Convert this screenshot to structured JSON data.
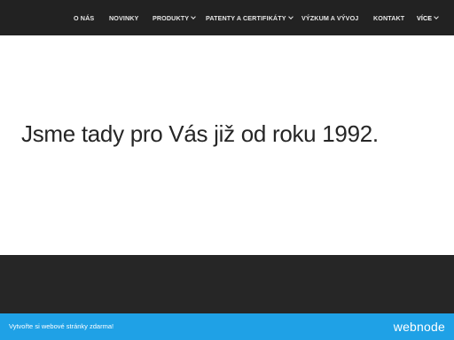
{
  "nav": {
    "items": [
      {
        "label": "O NÁS",
        "has_dropdown": false
      },
      {
        "label": "NOVINKY",
        "has_dropdown": false
      },
      {
        "label": "PRODUKTY",
        "has_dropdown": true
      },
      {
        "label": "PATENTY A CERTIFIKÁTY",
        "has_dropdown": true
      },
      {
        "label": "VÝZKUM A VÝVOJ",
        "has_dropdown": false
      },
      {
        "label": "KONTAKT",
        "has_dropdown": false
      },
      {
        "label": "VÍCE",
        "has_dropdown": true
      }
    ]
  },
  "hero": {
    "headline": "Jsme tady pro Vás již od roku 1992."
  },
  "footer": {
    "cta": "Vytvořte si webové stránky zdarma!",
    "logo": "webnode"
  },
  "colors": {
    "topbar": "#222222",
    "dark_section": "#262626",
    "footer_bar": "#1fa1e6",
    "headline_text": "#262626"
  },
  "icons": {
    "dropdown": "chevron-down-icon"
  }
}
